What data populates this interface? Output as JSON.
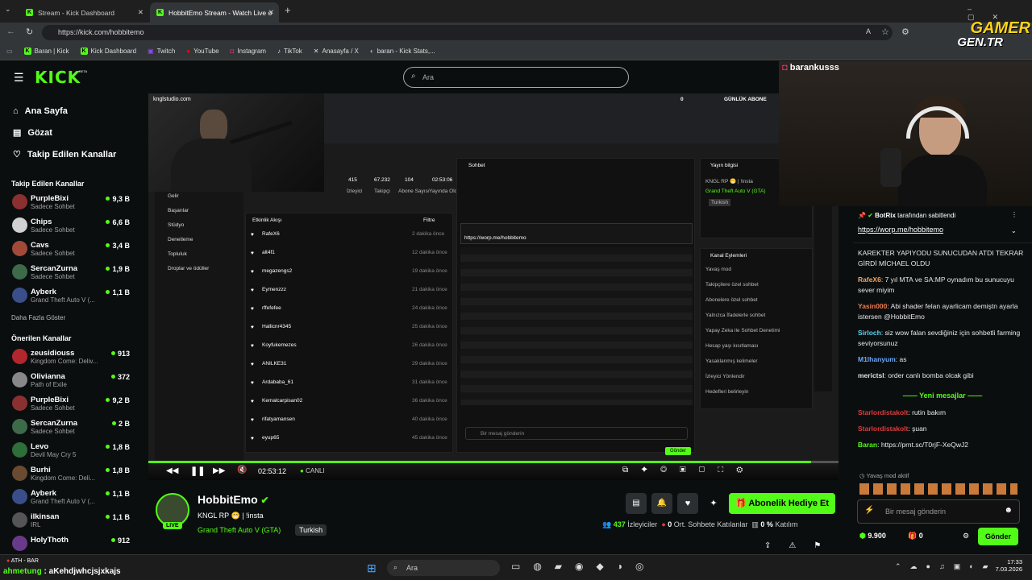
{
  "browser": {
    "tabs": [
      {
        "title": "Stream - Kick Dashboard"
      },
      {
        "title": "HobbitEmo Stream - Watch Live o"
      }
    ],
    "url": "https://kick.com/hobbitemo",
    "bookmarks": [
      "Baran | Kick",
      "Kick Dashboard",
      "Twitch",
      "YouTube",
      "Instagram",
      "TikTok",
      "Anasayfa / X",
      "baran - Kick Stats,..."
    ]
  },
  "watermark": {
    "line1": "GAMER",
    "line2": "GEN.TR"
  },
  "kick": {
    "logo": "KICK",
    "beta": "BETA",
    "search_placeholder": "Ara"
  },
  "sidebar": {
    "nav": [
      "Ana Sayfa",
      "Gözat",
      "Takip Edilen Kanallar"
    ],
    "followed_title": "Takip Edilen Kanallar",
    "followed": [
      {
        "name": "PurpleBixi",
        "game": "Sadece Sohbet",
        "viewers": "9,3 B",
        "color": "#8b3030"
      },
      {
        "name": "Chips",
        "game": "Sadece Sohbet",
        "viewers": "6,6 B",
        "color": "#d0d0d0"
      },
      {
        "name": "Cavs",
        "game": "Sadece Sohbet",
        "viewers": "3,4 B",
        "color": "#a14a3a"
      },
      {
        "name": "SercanZurna",
        "game": "Sadece Sohbet",
        "viewers": "1,9 B",
        "color": "#3d6b4a"
      },
      {
        "name": "Ayberk",
        "game": "Grand Theft Auto V (...",
        "viewers": "1,1 B",
        "color": "#3a4e8a"
      }
    ],
    "show_more": "Daha Fazla Göster",
    "recommended_title": "Önerilen Kanallar",
    "recommended": [
      {
        "name": "zeusidiouss",
        "game": "Kingdom Come: Deliv...",
        "viewers": "913",
        "color": "#b3262d"
      },
      {
        "name": "Olivianna",
        "game": "Path of Exile",
        "viewers": "372",
        "color": "#888"
      },
      {
        "name": "PurpleBixi",
        "game": "Sadece Sohbet",
        "viewers": "9,2 B",
        "color": "#8b3030"
      },
      {
        "name": "SercanZurna",
        "game": "Sadece Sohbet",
        "viewers": "2 B",
        "color": "#3d6b4a"
      },
      {
        "name": "Levo",
        "game": "Devil May Cry 5",
        "viewers": "1,8 B",
        "color": "#2d6e3a"
      },
      {
        "name": "Burhi",
        "game": "Kingdom Come: Deli...",
        "viewers": "1,8 B",
        "color": "#6a4a30"
      },
      {
        "name": "Ayberk",
        "game": "Grand Theft Auto V (...",
        "viewers": "1,1 B",
        "color": "#3a4e8a"
      },
      {
        "name": "ilkinsan",
        "game": "IRL",
        "viewers": "1,1 B",
        "color": "#555"
      },
      {
        "name": "HolyThoth",
        "game": "",
        "viewers": "912",
        "color": "#6a3a8a"
      }
    ]
  },
  "player": {
    "time": "02:53:12",
    "live": "CANLI"
  },
  "inner": {
    "studio": "knglstudio.com",
    "gunluk": "GÜNLÜK ABONE",
    "gunluk_val": "0",
    "stats": [
      {
        "v": "415",
        "l": "İzleyici"
      },
      {
        "v": "67.232",
        "l": "Takipçi"
      },
      {
        "v": "104",
        "l": "Abone Sayısı"
      },
      {
        "v": "02:53:06",
        "l": "Yayında Olduğu Süre"
      }
    ],
    "menu": [
      "Gelir",
      "Başarılar",
      "Stüdyo",
      "Denetleme",
      "Topluluk",
      "Droplar ve ödüller"
    ],
    "activity_title": "Etkinlik Akışı",
    "filter": "Filtre",
    "activity": [
      {
        "n": "RafeX6",
        "t": "2 dakika önce"
      },
      {
        "n": "alt4f1",
        "t": "12 dakika önce"
      },
      {
        "n": "megazengs2",
        "t": "19 dakika önce"
      },
      {
        "n": "Eymenzzz",
        "t": "21 dakika önce"
      },
      {
        "n": "rffefefee",
        "t": "24 dakika önce"
      },
      {
        "n": "Hallicnr4345",
        "t": "25 dakika önce"
      },
      {
        "n": "Koyfukemezes",
        "t": "26 dakika önce"
      },
      {
        "n": "ANILKE31",
        "t": "29 dakika önce"
      },
      {
        "n": "Ardababa_61",
        "t": "31 dakika önce"
      },
      {
        "n": "Kemalcarpisan02",
        "t": "36 dakika önce"
      },
      {
        "n": "rifatyamansen",
        "t": "40 dakika önce"
      },
      {
        "n": "eyup65",
        "t": "45 dakika önce"
      }
    ],
    "chat_title": "Sohbet",
    "chat_link": "https://worp.me/hobbitemo",
    "chat_input": "Bir mesaj gönderin",
    "send": "Gönder",
    "right_title": "Yayın bilgisi",
    "right_stream": "KNGL RP 😁 | !insta",
    "right_game": "Grand Theft Auto V (GTA)",
    "right_tag": "Turkish",
    "actions_title": "Kanal Eylemleri",
    "actions": [
      "Yavaş mod",
      "Takipçilere özel sohbet",
      "Abonelere özel sohbet",
      "Yalnızca İfadelerle sohbet",
      "Yapay Zeka ile Sohbet Denetimi",
      "Hesap yaşı kısıtlaması",
      "Yasaklanmış kelimeler",
      "İzleyici Yönlendir",
      "Hedefleri belirleyin"
    ]
  },
  "cam_name": "barankusss",
  "streamer": {
    "name": "HobbitEmo",
    "title": "KNGL RP 😁 | !insta",
    "game": "Grand Theft Auto V (GTA)",
    "tag": "Turkish",
    "live": "LIVE",
    "sub_button": "Abonelik Hediye Et",
    "viewers": "437",
    "viewers_label": "İzleyiciler",
    "engaged": "0",
    "engaged_label": "Ort. Sohbete Katılanlar",
    "rate": "0 %",
    "rate_label": "Katılım"
  },
  "chat": {
    "pinned_by": "BotRix",
    "pinned_suffix": "tarafından sabitlendi",
    "pinned_link": "https://worp.me/hobbitemo",
    "messages": [
      {
        "user": "",
        "color": "#fff",
        "text": "KAREKTER YAPIYODU SUNUCUDAN ATDI TEKRAR GİRDİ MİCHAEL OLDU"
      },
      {
        "user": "RafeX6",
        "color": "#f4a460",
        "text": "7 yıl MTA ve SA:MP oynadım bu sunucuyu sever miyim"
      },
      {
        "user": "Yasin000",
        "color": "#f47a4a",
        "text": "Abi shader felan ayarlicam demiştn ayarla istersen @HobbitEmo"
      },
      {
        "user": "Sirloch",
        "color": "#5fd0f0",
        "text": "siz wow falan sevdiğiniz için sohbetli farming seviyorsunuz"
      },
      {
        "user": "M1lhanyum",
        "color": "#6aa8ff",
        "text": "as"
      },
      {
        "user": "merictsl",
        "color": "#e0e0e0",
        "text": "order canlı bomba olcak gibi"
      }
    ],
    "new_messages": "Yeni mesajlar",
    "messages2": [
      {
        "user": "Starlordistakolt",
        "color": "#e03a3a",
        "text": "rutin bakım"
      },
      {
        "user": "Starlordistakolt",
        "color": "#e03a3a",
        "text": "şuan"
      },
      {
        "user": "Baran",
        "color": "#53fc18",
        "text": "https://prnt.sc/T0rjF-XeQwJ2"
      }
    ],
    "slow_mode": "Yavaş mod aktif",
    "input_placeholder": "Bir mesaj gönderin",
    "points": "9.900",
    "gifts": "0",
    "send": "Gönder"
  },
  "taskbar": {
    "ath": "ATH - BAR",
    "ticker": "ahmetung",
    "ticker2": "aKehdjwhcjsjxkajs",
    "search": "Ara",
    "time": "17:33",
    "date": "7.03.2026"
  }
}
